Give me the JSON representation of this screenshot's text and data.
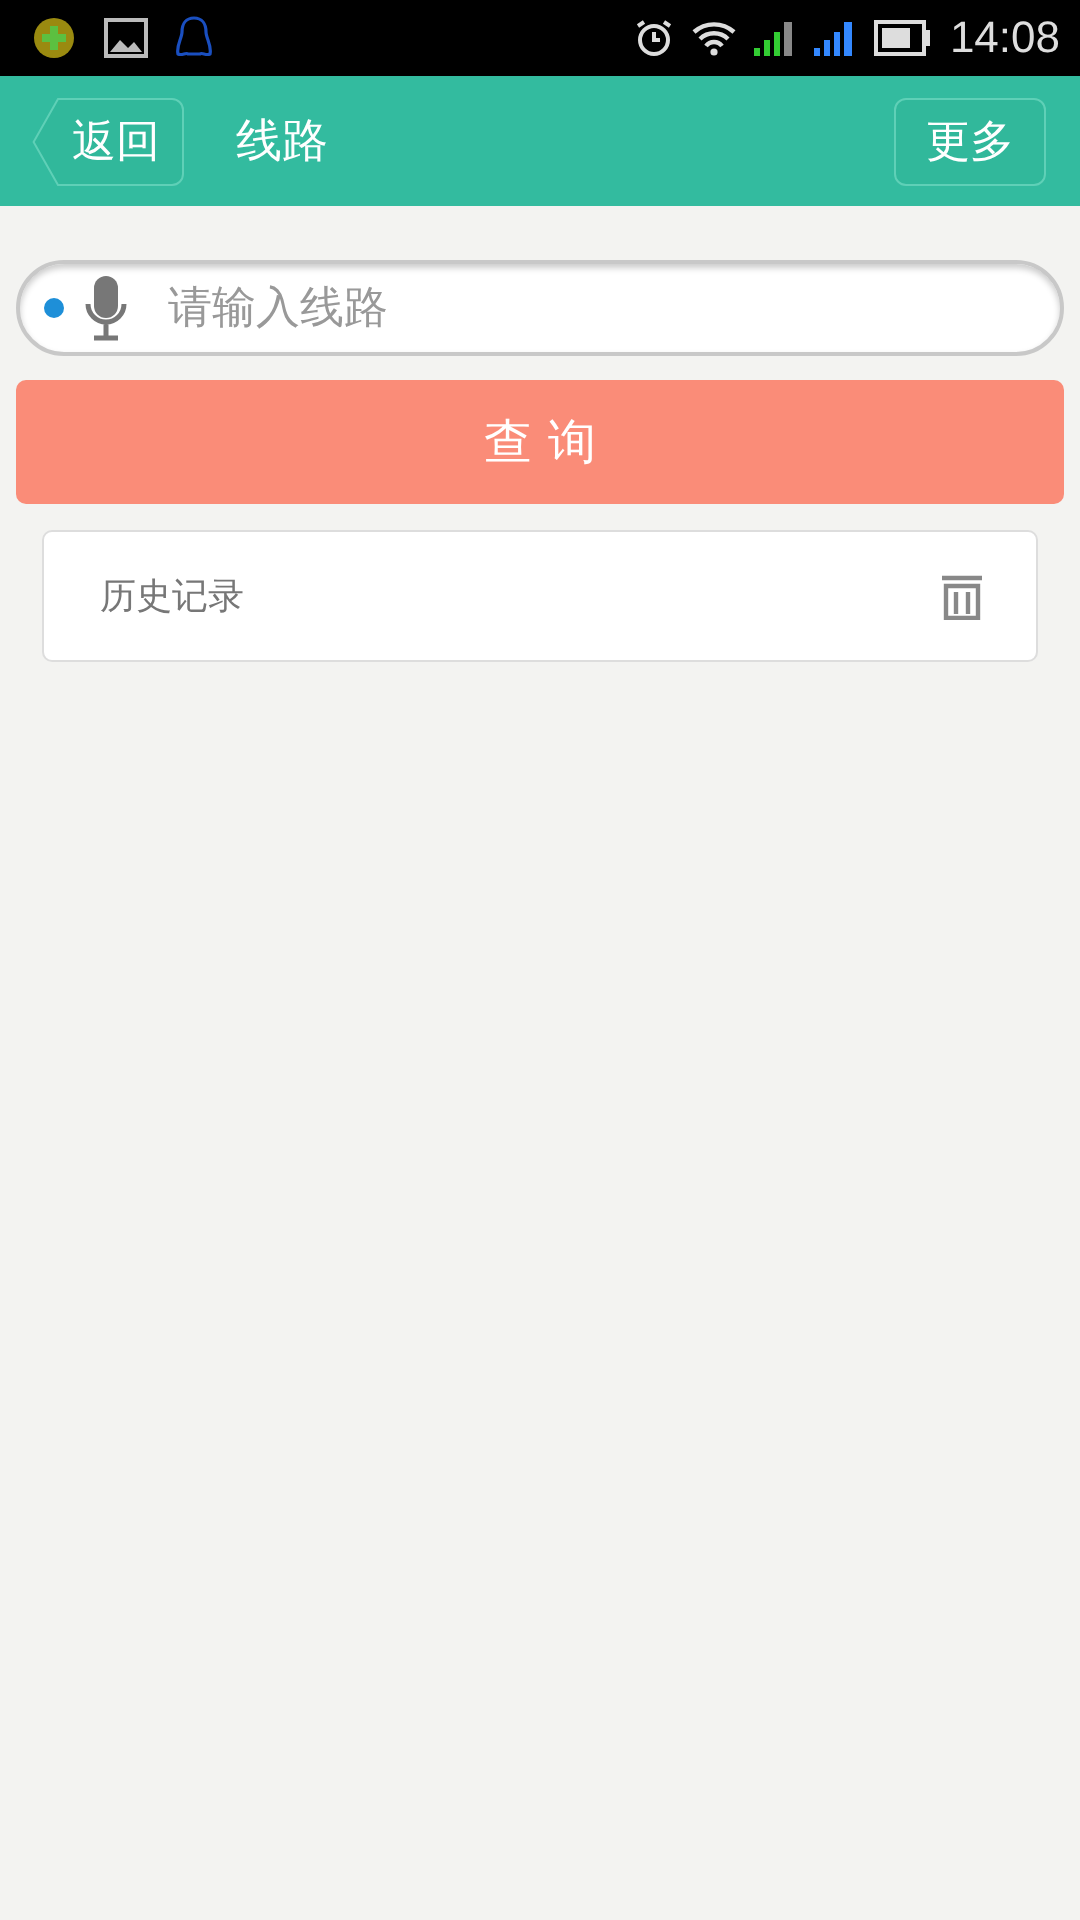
{
  "status_bar": {
    "time": "14:08"
  },
  "header": {
    "back": "返回",
    "title": "线路",
    "more": "更多"
  },
  "search": {
    "placeholder": "请输入线路"
  },
  "query_button": "查 询",
  "history": {
    "label": "历史记录"
  }
}
